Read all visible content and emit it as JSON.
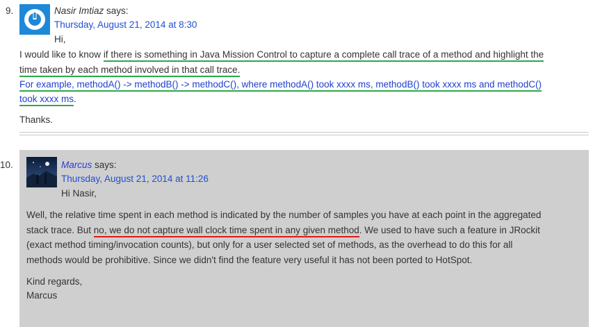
{
  "comments": [
    {
      "number": "9.",
      "author": "Nasir Imtiaz",
      "says": "says:",
      "timestamp": "Thursday, August 21, 2014 at 8:30",
      "greeting": "Hi,",
      "lines": [
        {
          "a": "I would like to know ",
          "u": "if there is something in Java Mission Control to capture a complete call trace of a method and highlight the"
        },
        {
          "u": "time taken by each method involved in that call trace."
        },
        {
          "u": "For example, methodA() -> methodB() -> methodC(), where methodA() took xxxx ms, methodB() took xxxx ms and methodC()"
        },
        {
          "u": "took xxxx ms",
          "b": "."
        }
      ],
      "closing": "Thanks.",
      "avatar_icon": "power-icon"
    },
    {
      "number": "10.",
      "author": "Marcus",
      "says": "says:",
      "timestamp": "Thursday, August 21, 2014 at 11:26",
      "greeting": "Hi Nasir,",
      "para1": [
        {
          "a": "Well, the relative time spent in each method is indicated by the number of samples you have at each point in the aggregated"
        },
        {
          "a": "stack trace. But ",
          "u": "no, we do not capture wall clock time spent in any given method",
          "b": ". We used to have such a feature in JRockit"
        },
        {
          "a": "(exact method timing/invocation counts), but only for a user selected set of methods, as the overhead to do this for all"
        },
        {
          "a": "methods would be prohibitive. Since we didn't find the feature very useful it has not been ported to HotSpot."
        }
      ],
      "signoff": [
        "Kind regards,",
        "Marcus"
      ],
      "avatar_icon": "night-landscape-avatar"
    }
  ],
  "colors": {
    "link": "#1f4fd3",
    "green_underline": "#2aa84a",
    "red_underline": "#e01919",
    "reply_bg": "#cfcfcf",
    "avatar_blue": "#1e88d8"
  }
}
